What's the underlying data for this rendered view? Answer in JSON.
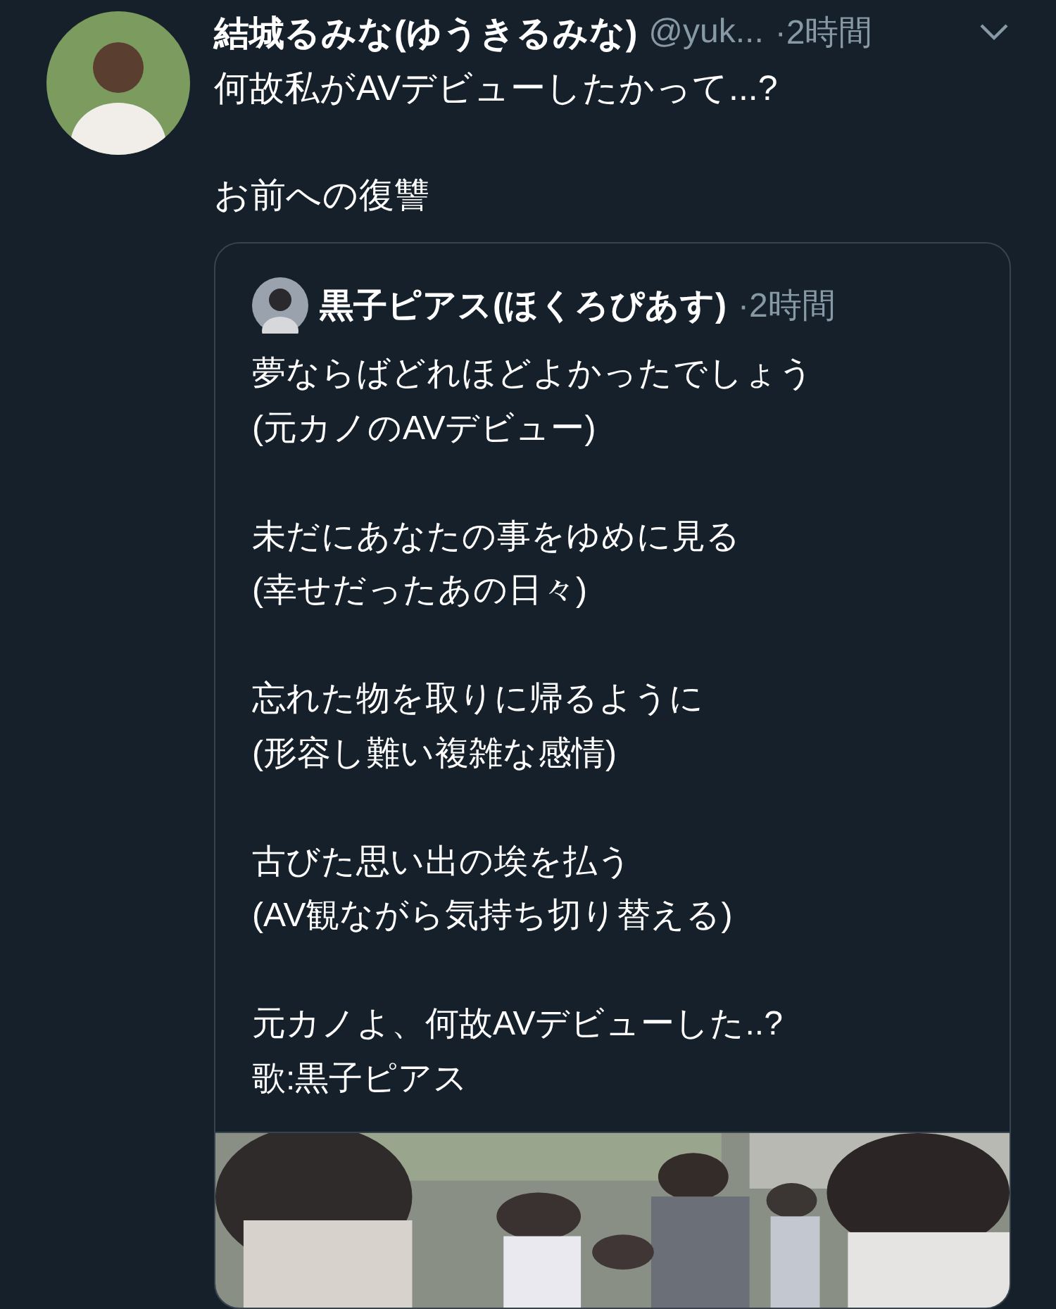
{
  "tweet": {
    "name": "結城るみな(ゆうきるみな)",
    "handle": "@yuk...",
    "time": "·2時間",
    "text": "何故私がAVデビューしたかって...?\n\nお前への復讐",
    "quote": {
      "name": "黒子ピアス(ほくろぴあす)",
      "time": "·2時間",
      "text": "夢ならばどれほどよかったでしょう\n(元カノのAVデビュー)\n\n未だにあなたの事をゆめに見る\n(幸せだったあの日々)\n\n忘れた物を取りに帰るように\n(形容し難い複雑な感情)\n\n古びた思い出の埃を払う\n(AV観ながら気持ち切り替える)\n\n元カノよ、何故AVデビューした..?\n歌:黒子ピアス"
    }
  }
}
